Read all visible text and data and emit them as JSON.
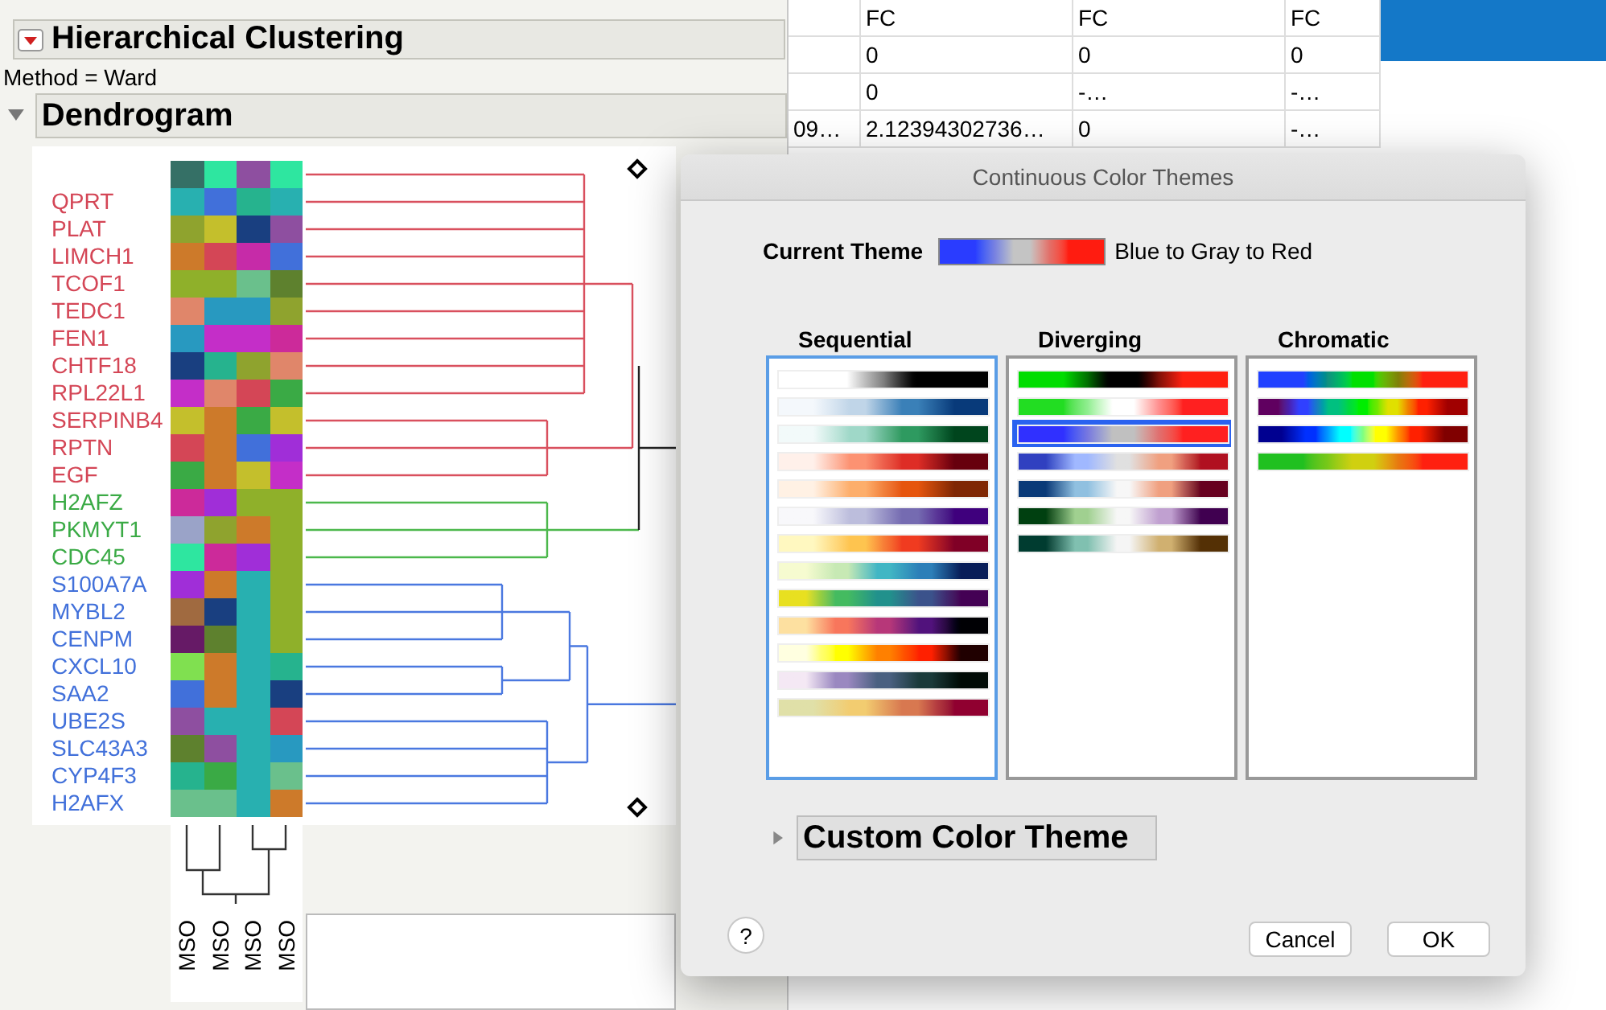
{
  "outline": {
    "title": "Hierarchical Clustering",
    "expanded": true
  },
  "method": "Method = Ward",
  "dendrogram": {
    "title": "Dendrogram",
    "expanded": true,
    "rows": [
      {
        "cells": [
          {
            "color": "#357066"
          },
          {
            "color": "#2ee6a0"
          },
          {
            "color": "#8e4fa0"
          },
          {
            "color": "#2ee6a0"
          }
        ]
      },
      {
        "label": "QPRT",
        "color": "#d44656",
        "cells": [
          {
            "color": "#28b0b0"
          },
          {
            "color": "#4170da"
          },
          {
            "color": "#26b38e"
          },
          {
            "color": "#28b0b0"
          }
        ]
      },
      {
        "label": "PLAT",
        "color": "#d44656",
        "cells": [
          {
            "color": "#8fa32e"
          },
          {
            "color": "#c4bf2c"
          },
          {
            "color": "#193f80"
          },
          {
            "color": "#8e4fa0"
          }
        ]
      },
      {
        "label": "LIMCH1",
        "color": "#d44656",
        "cells": [
          {
            "color": "#cd7a2a"
          },
          {
            "color": "#d44656"
          },
          {
            "color": "#c62ba8"
          },
          {
            "color": "#4170da"
          }
        ]
      },
      {
        "label": "TCOF1",
        "color": "#d44656",
        "cells": [
          {
            "color": "#8fb02a"
          },
          {
            "color": "#8fb02a"
          },
          {
            "color": "#6ac08c"
          },
          {
            "color": "#5e812e"
          }
        ]
      },
      {
        "label": "TEDC1",
        "color": "#d44656",
        "cells": [
          {
            "color": "#e0866a"
          },
          {
            "color": "#2899c0"
          },
          {
            "color": "#2899c0"
          },
          {
            "color": "#8fa32e"
          }
        ]
      },
      {
        "label": "FEN1",
        "color": "#d44656",
        "cells": [
          {
            "color": "#2899c0"
          },
          {
            "color": "#c42ec8"
          },
          {
            "color": "#c42ec8"
          },
          {
            "color": "#cc2a9a"
          }
        ]
      },
      {
        "label": "CHTF18",
        "color": "#d44656",
        "cells": [
          {
            "color": "#193f80"
          },
          {
            "color": "#26b38e"
          },
          {
            "color": "#8fa32e"
          },
          {
            "color": "#e0866a"
          }
        ]
      },
      {
        "label": "RPL22L1",
        "color": "#d44656",
        "cells": [
          {
            "color": "#c42ec8"
          },
          {
            "color": "#e0866a"
          },
          {
            "color": "#d44656"
          },
          {
            "color": "#3aaa45"
          }
        ]
      },
      {
        "label": "SERPINB4",
        "color": "#d44656",
        "cells": [
          {
            "color": "#c4bf2c"
          },
          {
            "color": "#cd7a2a"
          },
          {
            "color": "#3aaa45"
          },
          {
            "color": "#c4bf2c"
          }
        ]
      },
      {
        "label": "RPTN",
        "color": "#d44656",
        "cells": [
          {
            "color": "#d44656"
          },
          {
            "color": "#cd7a2a"
          },
          {
            "color": "#4170da"
          },
          {
            "color": "#a02ed8"
          }
        ]
      },
      {
        "label": "EGF",
        "color": "#d44656",
        "cells": [
          {
            "color": "#3aaa45"
          },
          {
            "color": "#cd7a2a"
          },
          {
            "color": "#c4bf2c"
          },
          {
            "color": "#c42ec8"
          }
        ]
      },
      {
        "label": "H2AFZ",
        "color": "#3aaa45",
        "cells": [
          {
            "color": "#cc2a9a"
          },
          {
            "color": "#a02ed8"
          },
          {
            "color": "#8fb02a"
          },
          {
            "color": "#8fb02a"
          }
        ]
      },
      {
        "label": "PKMYT1",
        "color": "#3aaa45",
        "cells": [
          {
            "color": "#9aa3c8"
          },
          {
            "color": "#8fa32e"
          },
          {
            "color": "#cd7a2a"
          },
          {
            "color": "#8fb02a"
          }
        ]
      },
      {
        "label": "CDC45",
        "color": "#3aaa45",
        "cells": [
          {
            "color": "#2ee6a0"
          },
          {
            "color": "#cc2a9a"
          },
          {
            "color": "#a02ed8"
          },
          {
            "color": "#8fb02a"
          }
        ]
      },
      {
        "label": "S100A7A",
        "color": "#4170da",
        "cells": [
          {
            "color": "#a02ed8"
          },
          {
            "color": "#cd7a2a"
          },
          {
            "color": "#28b0b0"
          },
          {
            "color": "#8fb02a"
          }
        ]
      },
      {
        "label": "MYBL2",
        "color": "#4170da",
        "cells": [
          {
            "color": "#a06a40"
          },
          {
            "color": "#193f80"
          },
          {
            "color": "#28b0b0"
          },
          {
            "color": "#8fb02a"
          }
        ]
      },
      {
        "label": "CENPM",
        "color": "#4170da",
        "cells": [
          {
            "color": "#661a66"
          },
          {
            "color": "#5e812e"
          },
          {
            "color": "#28b0b0"
          },
          {
            "color": "#8fb02a"
          }
        ]
      },
      {
        "label": "CXCL10",
        "color": "#4170da",
        "cells": [
          {
            "color": "#80e050"
          },
          {
            "color": "#cd7a2a"
          },
          {
            "color": "#28b0b0"
          },
          {
            "color": "#26b38e"
          }
        ]
      },
      {
        "label": "SAA2",
        "color": "#4170da",
        "cells": [
          {
            "color": "#4170da"
          },
          {
            "color": "#cd7a2a"
          },
          {
            "color": "#28b0b0"
          },
          {
            "color": "#193f80"
          }
        ]
      },
      {
        "label": "UBE2S",
        "color": "#4170da",
        "cells": [
          {
            "color": "#8e4fa0"
          },
          {
            "color": "#28b0b0"
          },
          {
            "color": "#28b0b0"
          },
          {
            "color": "#d44656"
          }
        ]
      },
      {
        "label": "SLC43A3",
        "color": "#4170da",
        "cells": [
          {
            "color": "#5e812e"
          },
          {
            "color": "#8e4fa0"
          },
          {
            "color": "#28b0b0"
          },
          {
            "color": "#2899c0"
          }
        ]
      },
      {
        "label": "CYP4F3",
        "color": "#4170da",
        "cells": [
          {
            "color": "#26b38e"
          },
          {
            "color": "#3aaa45"
          },
          {
            "color": "#28b0b0"
          },
          {
            "color": "#6ac08c"
          }
        ]
      },
      {
        "label": "H2AFX",
        "color": "#4170da",
        "cells": [
          {
            "color": "#6ac08c"
          },
          {
            "color": "#6ac08c"
          },
          {
            "color": "#28b0b0"
          },
          {
            "color": "#cd7a2a"
          }
        ]
      }
    ],
    "column_labels": [
      "MSO",
      "MSO",
      "MSO",
      "MSO"
    ]
  },
  "table": {
    "headers": [
      "FC",
      "FC",
      "FC"
    ],
    "rows": [
      {
        "values": [
          "0",
          "0",
          "0"
        ]
      },
      {
        "values": [
          "0",
          "-…",
          "-…"
        ]
      },
      {
        "column_1": "09…",
        "values": [
          "2.12394302736…",
          "0",
          "-…"
        ]
      }
    ]
  },
  "dialog": {
    "title": "Continuous Color Themes",
    "current_theme": {
      "label": "Current Theme",
      "name": "Blue to Gray to Red",
      "stops": [
        {
          "color": "#2a3cff"
        },
        {
          "color": "#c4c4c4"
        },
        {
          "color": "#ff1c10"
        }
      ]
    },
    "groups": [
      {
        "title": "Sequential",
        "focused": true,
        "themes": [
          {
            "selected": false,
            "stops": [
              {
                "color": "#ffffff"
              },
              {
                "color": "#000000"
              }
            ]
          },
          {
            "selected": false,
            "stops": [
              {
                "color": "#f4f8fc"
              },
              {
                "color": "#c0d5e8"
              },
              {
                "color": "#3a80b8"
              },
              {
                "color": "#083a7a"
              }
            ]
          },
          {
            "selected": false,
            "stops": [
              {
                "color": "#f2fafa"
              },
              {
                "color": "#9fd8c8"
              },
              {
                "color": "#2e9a60"
              },
              {
                "color": "#00451d"
              }
            ]
          },
          {
            "selected": false,
            "stops": [
              {
                "color": "#fff0ea"
              },
              {
                "color": "#fc9272"
              },
              {
                "color": "#de2d26"
              },
              {
                "color": "#67000d"
              }
            ]
          },
          {
            "selected": false,
            "stops": [
              {
                "color": "#fff1e4"
              },
              {
                "color": "#fdae6b"
              },
              {
                "color": "#e6550d"
              },
              {
                "color": "#7f2704"
              }
            ]
          },
          {
            "selected": false,
            "stops": [
              {
                "color": "#f8f8fb"
              },
              {
                "color": "#bcbddc"
              },
              {
                "color": "#756bb1"
              },
              {
                "color": "#3f007d"
              }
            ]
          },
          {
            "selected": false,
            "stops": [
              {
                "color": "#fff8c0"
              },
              {
                "color": "#fec44f"
              },
              {
                "color": "#f03b20"
              },
              {
                "color": "#800026"
              }
            ]
          },
          {
            "selected": false,
            "stops": [
              {
                "color": "#f6fbd0"
              },
              {
                "color": "#c7e9b4"
              },
              {
                "color": "#41b6c4"
              },
              {
                "color": "#2c7fb8"
              },
              {
                "color": "#081d58"
              }
            ]
          },
          {
            "selected": false,
            "stops": [
              {
                "color": "#e8e020"
              },
              {
                "color": "#44bb60"
              },
              {
                "color": "#21918c"
              },
              {
                "color": "#3b528b"
              },
              {
                "color": "#440154"
              }
            ]
          },
          {
            "selected": false,
            "stops": [
              {
                "color": "#fde0a0"
              },
              {
                "color": "#f8765c"
              },
              {
                "color": "#b73779"
              },
              {
                "color": "#51127c"
              },
              {
                "color": "#000004"
              }
            ]
          },
          {
            "selected": false,
            "stops": [
              {
                "color": "#ffffe0"
              },
              {
                "color": "#ffff00"
              },
              {
                "color": "#ff8000"
              },
              {
                "color": "#ff2000"
              },
              {
                "color": "#200000"
              }
            ]
          },
          {
            "selected": false,
            "stops": [
              {
                "color": "#f4e8f4"
              },
              {
                "color": "#9a88c0"
              },
              {
                "color": "#4a6080"
              },
              {
                "color": "#1a3a3a"
              },
              {
                "color": "#000a05"
              }
            ]
          },
          {
            "selected": false,
            "stops": [
              {
                "color": "#e0e0a8"
              },
              {
                "color": "#f2cc70"
              },
              {
                "color": "#d87850"
              },
              {
                "color": "#900030"
              }
            ]
          }
        ]
      },
      {
        "title": "Diverging",
        "focused": false,
        "themes": [
          {
            "selected": false,
            "stops": [
              {
                "color": "#00dd00"
              },
              {
                "color": "#000000"
              },
              {
                "color": "#ff2010"
              }
            ]
          },
          {
            "selected": false,
            "stops": [
              {
                "color": "#22dd22"
              },
              {
                "color": "#ffffff"
              },
              {
                "color": "#ff2020"
              }
            ]
          },
          {
            "selected": true,
            "stops": [
              {
                "color": "#3030ff"
              },
              {
                "color": "#c0c0c0"
              },
              {
                "color": "#ff2020"
              }
            ]
          },
          {
            "selected": false,
            "stops": [
              {
                "color": "#3040c0"
              },
              {
                "color": "#a0b8ff"
              },
              {
                "color": "#e0e0e0"
              },
              {
                "color": "#f0a080"
              },
              {
                "color": "#b01020"
              }
            ]
          },
          {
            "selected": false,
            "stops": [
              {
                "color": "#0a3a78"
              },
              {
                "color": "#90c0e0"
              },
              {
                "color": "#f7f7f7"
              },
              {
                "color": "#f0a080"
              },
              {
                "color": "#67001f"
              }
            ]
          },
          {
            "selected": false,
            "stops": [
              {
                "color": "#004010"
              },
              {
                "color": "#a0d090"
              },
              {
                "color": "#f7f7f7"
              },
              {
                "color": "#c0a0d0"
              },
              {
                "color": "#400050"
              }
            ]
          },
          {
            "selected": false,
            "stops": [
              {
                "color": "#003c30"
              },
              {
                "color": "#80c0b0"
              },
              {
                "color": "#f5f5f5"
              },
              {
                "color": "#d0b070"
              },
              {
                "color": "#543005"
              }
            ]
          }
        ]
      },
      {
        "title": "Chromatic",
        "focused": false,
        "themes": [
          {
            "selected": false,
            "stops": [
              {
                "color": "#2040ff"
              },
              {
                "color": "#00e000"
              },
              {
                "color": "#ff2010"
              }
            ]
          },
          {
            "selected": false,
            "stops": [
              {
                "color": "#600060"
              },
              {
                "color": "#3040ff"
              },
              {
                "color": "#00c080"
              },
              {
                "color": "#00ee00"
              },
              {
                "color": "#e0e000"
              },
              {
                "color": "#ff2000"
              },
              {
                "color": "#a00000"
              }
            ]
          },
          {
            "selected": false,
            "stops": [
              {
                "color": "#000090"
              },
              {
                "color": "#0030ff"
              },
              {
                "color": "#00ffff"
              },
              {
                "color": "#ffff00"
              },
              {
                "color": "#ff2000"
              },
              {
                "color": "#800000"
              }
            ]
          },
          {
            "selected": false,
            "stops": [
              {
                "color": "#20c020"
              },
              {
                "color": "#d0d010"
              },
              {
                "color": "#ff2010"
              }
            ]
          }
        ]
      }
    ],
    "custom": {
      "title": "Custom Color Theme",
      "expanded": false
    },
    "help": "?",
    "buttons": [
      "Cancel",
      "OK"
    ]
  }
}
